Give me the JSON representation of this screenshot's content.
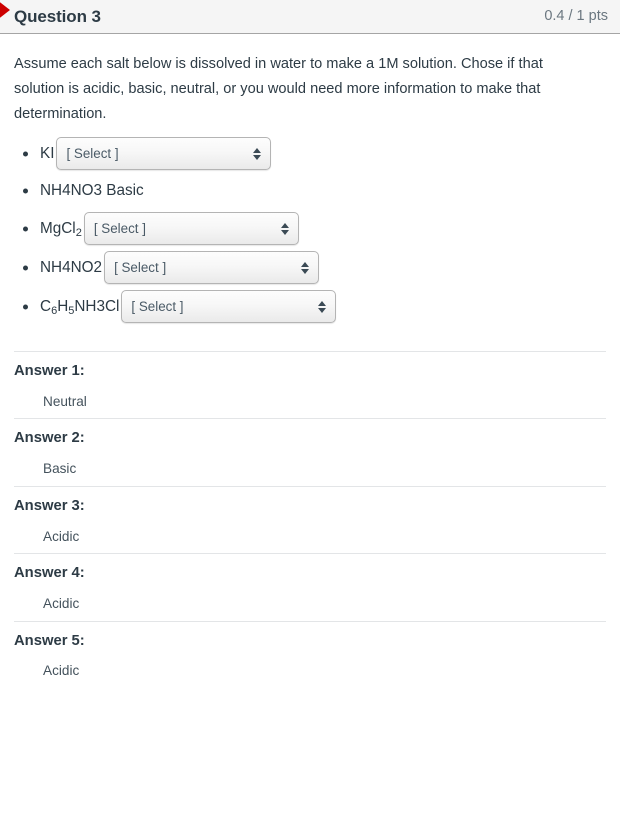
{
  "header": {
    "question_title": "Question 3",
    "points": "0.4 / 1 pts",
    "flag_icon": "flag-marker-icon",
    "accent_color": "#cc0000",
    "background_color": "#f5f5f5"
  },
  "question": {
    "prompt": "Assume each salt below is dissolved in water to make a 1M solution. Chose if that solution is acidic, basic, neutral, or you would need more information to make that determination.",
    "items": [
      {
        "formula_parts": [
          {
            "text": "KI",
            "sub": false
          }
        ],
        "has_select": true,
        "select_value": "[ Select ]",
        "inline_answer": ""
      },
      {
        "formula_parts": [
          {
            "text": "NH4NO3 Basic",
            "sub": false
          }
        ],
        "has_select": false,
        "select_value": "",
        "inline_answer": "Basic"
      },
      {
        "formula_parts": [
          {
            "text": "MgCl",
            "sub": false
          },
          {
            "text": "2",
            "sub": true
          }
        ],
        "has_select": true,
        "select_value": "[ Select ]",
        "inline_answer": ""
      },
      {
        "formula_parts": [
          {
            "text": "NH4NO2",
            "sub": false
          }
        ],
        "has_select": true,
        "select_value": "[ Select ]",
        "inline_answer": ""
      },
      {
        "formula_parts": [
          {
            "text": "C",
            "sub": false
          },
          {
            "text": "6",
            "sub": true
          },
          {
            "text": "H",
            "sub": false
          },
          {
            "text": "5",
            "sub": true
          },
          {
            "text": "NH3Cl",
            "sub": false
          }
        ],
        "has_select": true,
        "select_value": "[ Select ]",
        "inline_answer": ""
      }
    ]
  },
  "answers": [
    {
      "label": "Answer 1:",
      "value": "Neutral"
    },
    {
      "label": "Answer 2:",
      "value": "Basic"
    },
    {
      "label": "Answer 3:",
      "value": "Acidic"
    },
    {
      "label": "Answer 4:",
      "value": "Acidic"
    },
    {
      "label": "Answer 5:",
      "value": "Acidic"
    }
  ]
}
